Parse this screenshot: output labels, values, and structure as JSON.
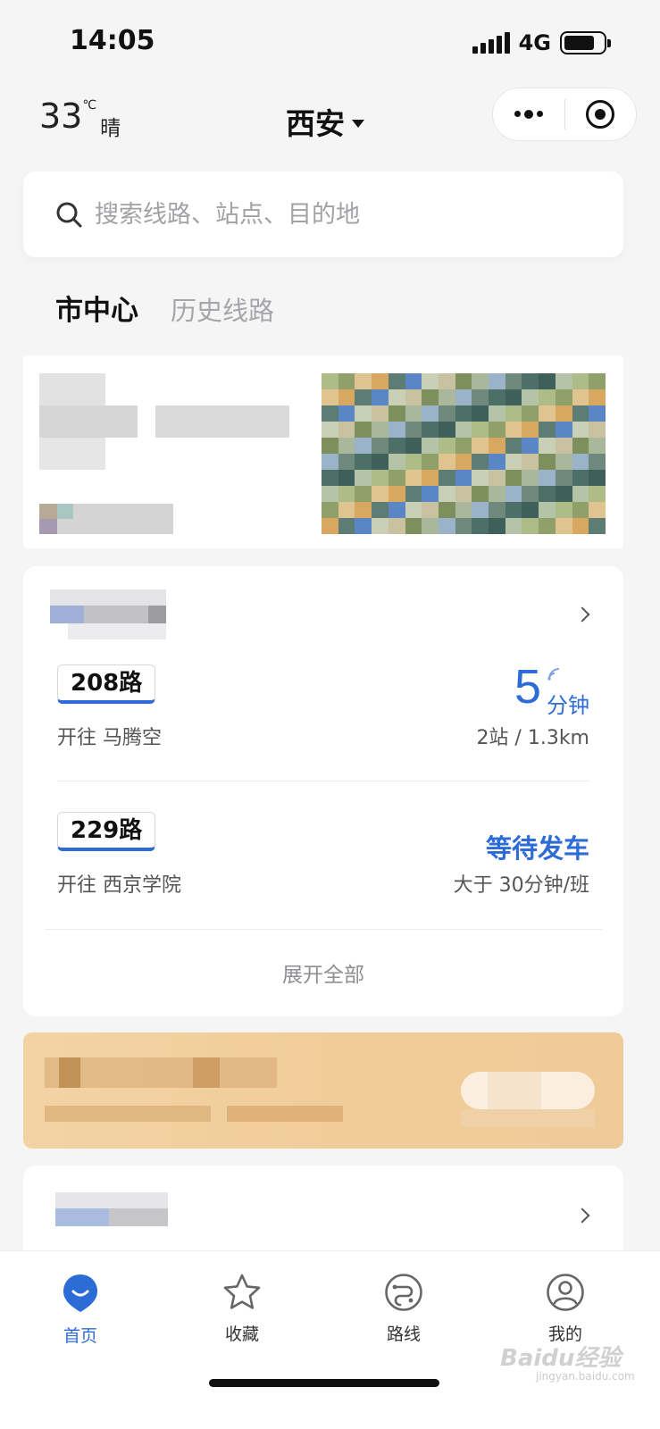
{
  "status_bar": {
    "time": "14:05",
    "network": "4G"
  },
  "header": {
    "temperature": "33",
    "temp_unit": "℃",
    "condition": "晴",
    "city": "西安"
  },
  "search": {
    "placeholder": "搜索线路、站点、目的地"
  },
  "tabs": [
    "市中心",
    "历史线路"
  ],
  "routes": [
    {
      "number": "208路",
      "direction": "开往 马腾空",
      "eta_value": "5",
      "eta_unit": "分钟",
      "info": "2站 / 1.3km"
    },
    {
      "number": "229路",
      "direction": "开往 西京学院",
      "status": "等待发车",
      "info": "大于 30分钟/班"
    }
  ],
  "expand_label": "展开全部",
  "tabbar": [
    {
      "label": "首页",
      "icon": "home-icon",
      "active": true
    },
    {
      "label": "收藏",
      "icon": "star-icon",
      "active": false
    },
    {
      "label": "路线",
      "icon": "route-icon",
      "active": false
    },
    {
      "label": "我的",
      "icon": "user-icon",
      "active": false
    }
  ],
  "watermark": "Baidu经验",
  "watermark_sub": "jingyan.baidu.com",
  "colors": {
    "accent": "#2d6cd6",
    "background": "#f5f5f6",
    "gold": "#f0cc98"
  }
}
